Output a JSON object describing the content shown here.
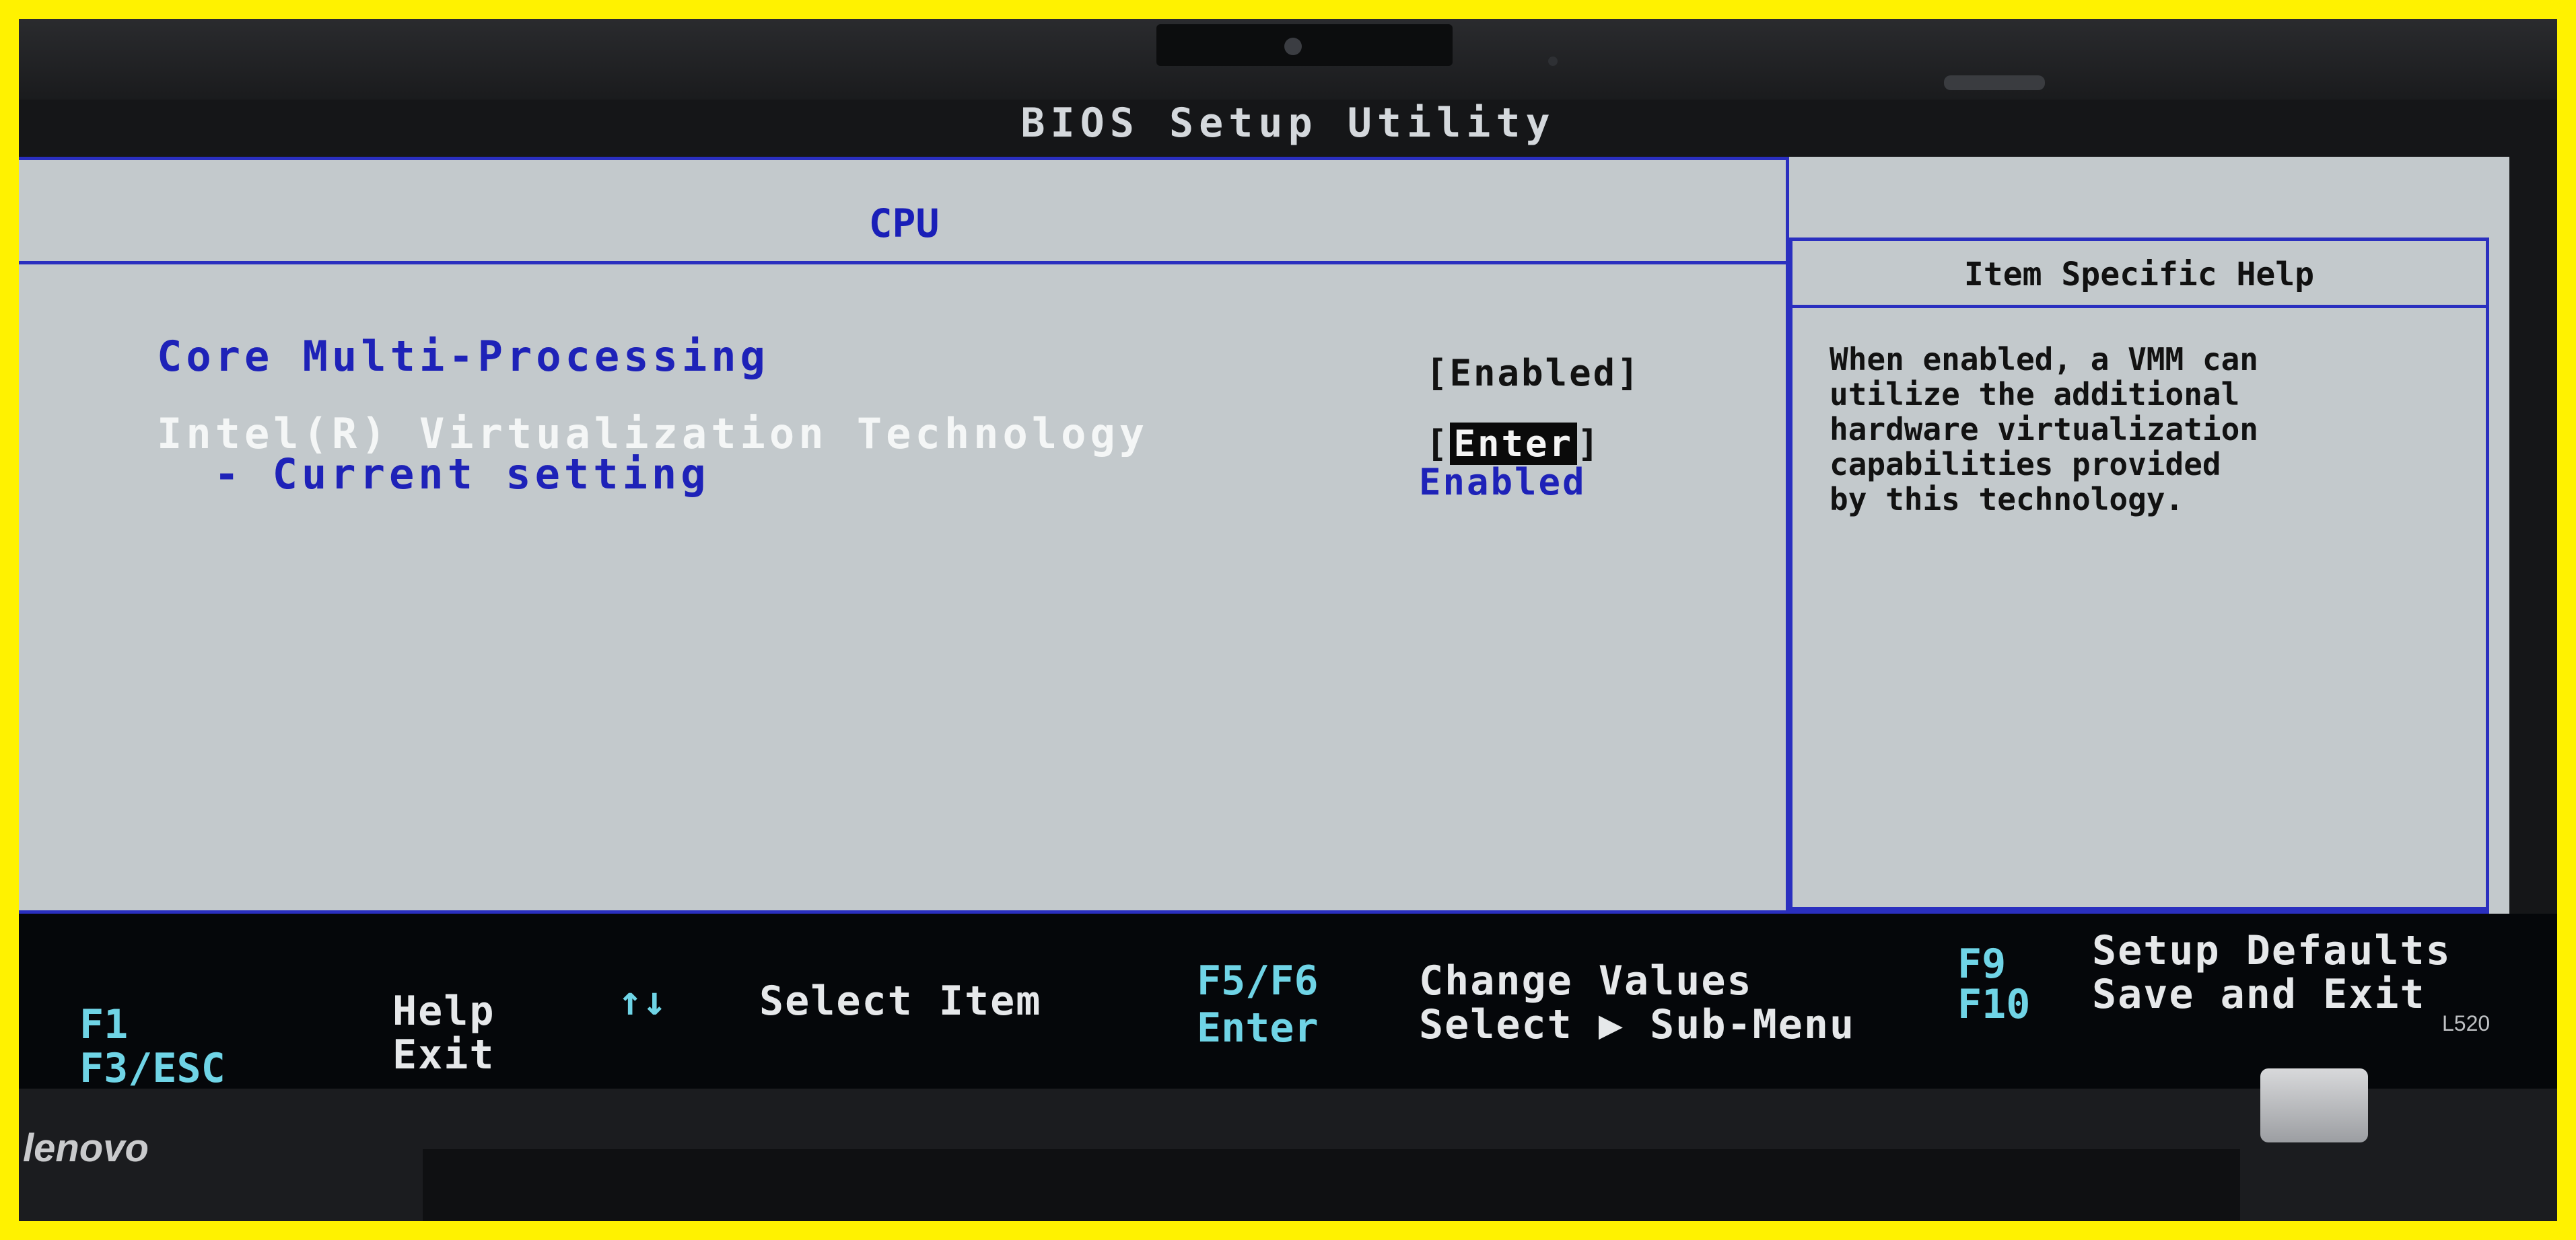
{
  "window": {
    "title": "BIOS Setup Utility"
  },
  "tab": {
    "title": "CPU"
  },
  "settings": [
    {
      "label": "Core Multi-Processing",
      "value": "[Enabled]"
    },
    {
      "label": "Intel(R) Virtualization Technology",
      "value_prefix": "[",
      "value": "Enter",
      "value_suffix": "]"
    },
    {
      "label": "- Current setting",
      "value": "Enabled"
    }
  ],
  "help": {
    "title": "Item Specific Help",
    "text": "When enabled, a VMM can\nutilize the additional\nhardware virtualization\ncapabilities provided\nby this technology."
  },
  "footer": {
    "keys": [
      {
        "key": "F1",
        "desc": "Help"
      },
      {
        "key": "F3/ESC",
        "desc": "Exit"
      },
      {
        "key": "↑↓",
        "desc": "Select Item"
      },
      {
        "key": "F5/F6",
        "desc": "Change Values"
      },
      {
        "key": "Enter",
        "desc": "Select ▶ Sub-Menu"
      },
      {
        "key": "F9",
        "desc": "Setup Defaults"
      },
      {
        "key": "F10",
        "desc": "Save and Exit"
      }
    ]
  },
  "device": {
    "brand": "lenovo",
    "model": "L520"
  },
  "colors": {
    "frame": "#fff200",
    "screen_bg": "#c3c9cc",
    "border_blue": "#2a2fbf",
    "label_blue": "#1e22b8",
    "label_selected": "#f4f6f6",
    "footer_key": "#6fd4e6"
  }
}
